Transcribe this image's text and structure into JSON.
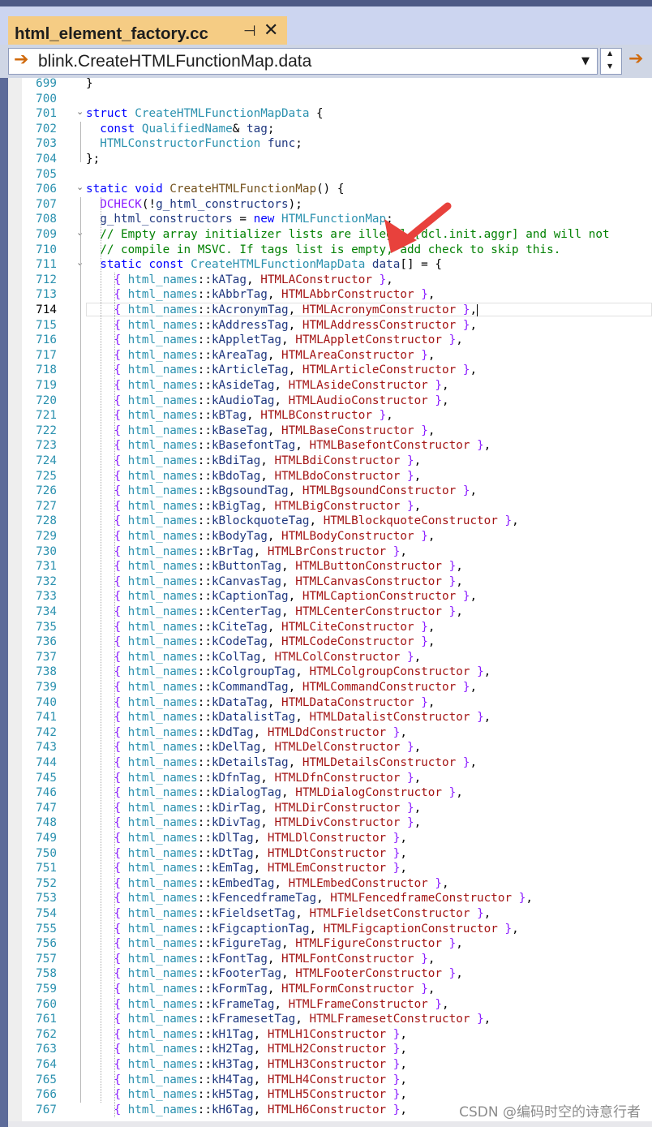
{
  "window": {
    "tab_title": "html_element_factory.cc",
    "pin_icon": "pin-icon",
    "close_icon": "close-icon"
  },
  "navbar": {
    "scope": "blink.CreateHTMLFunctionMap.data"
  },
  "editor": {
    "current_line": "714",
    "header": [
      {
        "n": "699",
        "tokens": [
          [
            "p",
            "}"
          ]
        ]
      },
      {
        "n": "700",
        "tokens": []
      },
      {
        "n": "701",
        "tokens": [
          [
            "k",
            "struct "
          ],
          [
            "t",
            "CreateHTMLFunctionMapData"
          ],
          [
            "p",
            " {"
          ]
        ]
      },
      {
        "n": "702",
        "tokens": [
          [
            "p",
            "  "
          ],
          [
            "k",
            "const "
          ],
          [
            "t",
            "QualifiedName"
          ],
          [
            "p",
            "& "
          ],
          [
            "v",
            "tag"
          ],
          [
            "p",
            ";"
          ]
        ]
      },
      {
        "n": "703",
        "tokens": [
          [
            "p",
            "  "
          ],
          [
            "t",
            "HTMLConstructorFunction "
          ],
          [
            "v",
            "func"
          ],
          [
            "p",
            ";"
          ]
        ]
      },
      {
        "n": "704",
        "tokens": [
          [
            "p",
            "};"
          ]
        ]
      },
      {
        "n": "705",
        "tokens": []
      },
      {
        "n": "706",
        "tokens": [
          [
            "k",
            "static void "
          ],
          [
            "f",
            "CreateHTMLFunctionMap"
          ],
          [
            "p",
            "() {"
          ]
        ]
      },
      {
        "n": "707",
        "tokens": [
          [
            "p",
            "  "
          ],
          [
            "m",
            "DCHECK"
          ],
          [
            "p",
            "(!"
          ],
          [
            "v",
            "g_html_constructors"
          ],
          [
            "p",
            ");"
          ]
        ]
      },
      {
        "n": "708",
        "tokens": [
          [
            "p",
            "  "
          ],
          [
            "v",
            "g_html_constructors"
          ],
          [
            "p",
            " = "
          ],
          [
            "k",
            "new "
          ],
          [
            "t",
            "HTMLFunctionMap"
          ],
          [
            "p",
            ";"
          ]
        ]
      },
      {
        "n": "709",
        "tokens": [
          [
            "p",
            "  "
          ],
          [
            "c",
            "// Empty array initializer lists are illegal [dcl.init.aggr] and will not"
          ]
        ]
      },
      {
        "n": "710",
        "tokens": [
          [
            "p",
            "  "
          ],
          [
            "c",
            "// compile in MSVC. If tags list is empty, add check to skip this."
          ]
        ]
      },
      {
        "n": "711",
        "tokens": [
          [
            "p",
            "  "
          ],
          [
            "k",
            "static const "
          ],
          [
            "t",
            "CreateHTMLFunctionMapData "
          ],
          [
            "v",
            "data"
          ],
          [
            "p",
            "[] = {"
          ]
        ]
      }
    ],
    "entries": [
      {
        "n": "712",
        "tag": "kATag",
        "ctor": "HTMLAConstructor"
      },
      {
        "n": "713",
        "tag": "kAbbrTag",
        "ctor": "HTMLAbbrConstructor"
      },
      {
        "n": "714",
        "tag": "kAcronymTag",
        "ctor": "HTMLAcronymConstructor"
      },
      {
        "n": "715",
        "tag": "kAddressTag",
        "ctor": "HTMLAddressConstructor"
      },
      {
        "n": "716",
        "tag": "kAppletTag",
        "ctor": "HTMLAppletConstructor"
      },
      {
        "n": "717",
        "tag": "kAreaTag",
        "ctor": "HTMLAreaConstructor"
      },
      {
        "n": "718",
        "tag": "kArticleTag",
        "ctor": "HTMLArticleConstructor"
      },
      {
        "n": "719",
        "tag": "kAsideTag",
        "ctor": "HTMLAsideConstructor"
      },
      {
        "n": "720",
        "tag": "kAudioTag",
        "ctor": "HTMLAudioConstructor"
      },
      {
        "n": "721",
        "tag": "kBTag",
        "ctor": "HTMLBConstructor"
      },
      {
        "n": "722",
        "tag": "kBaseTag",
        "ctor": "HTMLBaseConstructor"
      },
      {
        "n": "723",
        "tag": "kBasefontTag",
        "ctor": "HTMLBasefontConstructor"
      },
      {
        "n": "724",
        "tag": "kBdiTag",
        "ctor": "HTMLBdiConstructor"
      },
      {
        "n": "725",
        "tag": "kBdoTag",
        "ctor": "HTMLBdoConstructor"
      },
      {
        "n": "726",
        "tag": "kBgsoundTag",
        "ctor": "HTMLBgsoundConstructor"
      },
      {
        "n": "727",
        "tag": "kBigTag",
        "ctor": "HTMLBigConstructor"
      },
      {
        "n": "728",
        "tag": "kBlockquoteTag",
        "ctor": "HTMLBlockquoteConstructor"
      },
      {
        "n": "729",
        "tag": "kBodyTag",
        "ctor": "HTMLBodyConstructor"
      },
      {
        "n": "730",
        "tag": "kBrTag",
        "ctor": "HTMLBrConstructor"
      },
      {
        "n": "731",
        "tag": "kButtonTag",
        "ctor": "HTMLButtonConstructor"
      },
      {
        "n": "732",
        "tag": "kCanvasTag",
        "ctor": "HTMLCanvasConstructor"
      },
      {
        "n": "733",
        "tag": "kCaptionTag",
        "ctor": "HTMLCaptionConstructor"
      },
      {
        "n": "734",
        "tag": "kCenterTag",
        "ctor": "HTMLCenterConstructor"
      },
      {
        "n": "735",
        "tag": "kCiteTag",
        "ctor": "HTMLCiteConstructor"
      },
      {
        "n": "736",
        "tag": "kCodeTag",
        "ctor": "HTMLCodeConstructor"
      },
      {
        "n": "737",
        "tag": "kColTag",
        "ctor": "HTMLColConstructor"
      },
      {
        "n": "738",
        "tag": "kColgroupTag",
        "ctor": "HTMLColgroupConstructor"
      },
      {
        "n": "739",
        "tag": "kCommandTag",
        "ctor": "HTMLCommandConstructor"
      },
      {
        "n": "740",
        "tag": "kDataTag",
        "ctor": "HTMLDataConstructor"
      },
      {
        "n": "741",
        "tag": "kDatalistTag",
        "ctor": "HTMLDatalistConstructor"
      },
      {
        "n": "742",
        "tag": "kDdTag",
        "ctor": "HTMLDdConstructor"
      },
      {
        "n": "743",
        "tag": "kDelTag",
        "ctor": "HTMLDelConstructor"
      },
      {
        "n": "744",
        "tag": "kDetailsTag",
        "ctor": "HTMLDetailsConstructor"
      },
      {
        "n": "745",
        "tag": "kDfnTag",
        "ctor": "HTMLDfnConstructor"
      },
      {
        "n": "746",
        "tag": "kDialogTag",
        "ctor": "HTMLDialogConstructor"
      },
      {
        "n": "747",
        "tag": "kDirTag",
        "ctor": "HTMLDirConstructor"
      },
      {
        "n": "748",
        "tag": "kDivTag",
        "ctor": "HTMLDivConstructor"
      },
      {
        "n": "749",
        "tag": "kDlTag",
        "ctor": "HTMLDlConstructor"
      },
      {
        "n": "750",
        "tag": "kDtTag",
        "ctor": "HTMLDtConstructor"
      },
      {
        "n": "751",
        "tag": "kEmTag",
        "ctor": "HTMLEmConstructor"
      },
      {
        "n": "752",
        "tag": "kEmbedTag",
        "ctor": "HTMLEmbedConstructor"
      },
      {
        "n": "753",
        "tag": "kFencedframeTag",
        "ctor": "HTMLFencedframeConstructor"
      },
      {
        "n": "754",
        "tag": "kFieldsetTag",
        "ctor": "HTMLFieldsetConstructor"
      },
      {
        "n": "755",
        "tag": "kFigcaptionTag",
        "ctor": "HTMLFigcaptionConstructor"
      },
      {
        "n": "756",
        "tag": "kFigureTag",
        "ctor": "HTMLFigureConstructor"
      },
      {
        "n": "757",
        "tag": "kFontTag",
        "ctor": "HTMLFontConstructor"
      },
      {
        "n": "758",
        "tag": "kFooterTag",
        "ctor": "HTMLFooterConstructor"
      },
      {
        "n": "759",
        "tag": "kFormTag",
        "ctor": "HTMLFormConstructor"
      },
      {
        "n": "760",
        "tag": "kFrameTag",
        "ctor": "HTMLFrameConstructor"
      },
      {
        "n": "761",
        "tag": "kFramesetTag",
        "ctor": "HTMLFramesetConstructor"
      },
      {
        "n": "762",
        "tag": "kH1Tag",
        "ctor": "HTMLH1Constructor"
      },
      {
        "n": "763",
        "tag": "kH2Tag",
        "ctor": "HTMLH2Constructor"
      },
      {
        "n": "764",
        "tag": "kH3Tag",
        "ctor": "HTMLH3Constructor"
      },
      {
        "n": "765",
        "tag": "kH4Tag",
        "ctor": "HTMLH4Constructor"
      },
      {
        "n": "766",
        "tag": "kH5Tag",
        "ctor": "HTMLH5Constructor"
      },
      {
        "n": "767",
        "tag": "kH6Tag",
        "ctor": "HTMLH6Constructor"
      }
    ],
    "namespace": "html_names",
    "scope_op": "::"
  },
  "watermark": "CSDN @编码时空的诗意行者",
  "colors": {
    "keyword": "#0000ff",
    "type": "#2b91af",
    "comment": "#008000",
    "tab_active": "#f5cc84",
    "annotation_arrow": "#e8413c"
  }
}
